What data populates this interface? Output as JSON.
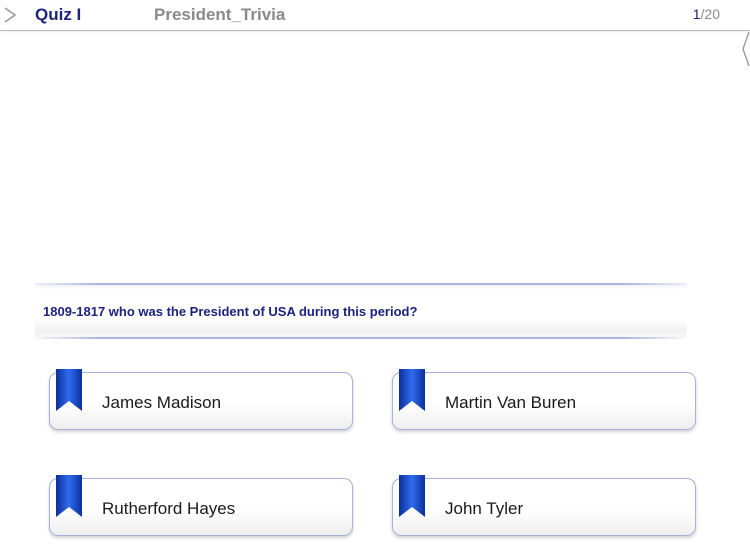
{
  "header": {
    "quiz_label": "Quiz I",
    "quiz_title": "President_Trivia",
    "progress": {
      "current": "1",
      "total": "/20"
    }
  },
  "question": {
    "text": "1809-1817 who was the President of USA during this period?"
  },
  "answers": [
    {
      "label": "James Madison",
      "icon": "bookmark-ribbon-icon"
    },
    {
      "label": "Martin Van Buren",
      "icon": "bookmark-ribbon-icon"
    },
    {
      "label": "Rutherford Hayes",
      "icon": "bookmark-ribbon-icon"
    },
    {
      "label": "John Tyler",
      "icon": "bookmark-ribbon-icon"
    }
  ],
  "colors": {
    "accent_navy": "#1a237e",
    "muted_gray": "#8a8a8a",
    "ribbon_blue": "#1f4fc7",
    "button_border": "#a7b2dc"
  }
}
